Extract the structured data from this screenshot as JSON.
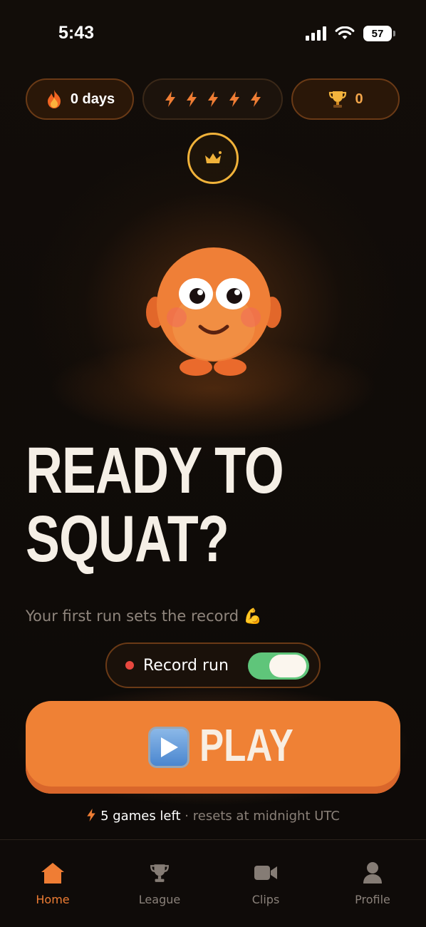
{
  "status_bar": {
    "time": "5:43",
    "battery": "57"
  },
  "top_stats": {
    "streak_label": "0 days",
    "energy_bolts": [
      "⚡",
      "⚡",
      "⚡",
      "⚡",
      "⚡"
    ],
    "trophies": "0"
  },
  "hero": {
    "headline_line1": "READY TO",
    "headline_line2": "SQUAT?",
    "subtitle": "Your first run sets the record 💪"
  },
  "record": {
    "label": "Record run",
    "enabled": true
  },
  "play": {
    "label": "PLAY"
  },
  "games": {
    "count_text": "5 games left",
    "reset_text": " · resets at midnight UTC"
  },
  "tabs": [
    {
      "label": "Home",
      "icon": "home-icon",
      "active": true
    },
    {
      "label": "League",
      "icon": "trophy-icon",
      "active": false
    },
    {
      "label": "Clips",
      "icon": "video-icon",
      "active": false
    },
    {
      "label": "Profile",
      "icon": "person-icon",
      "active": false
    }
  ],
  "colors": {
    "accent": "#ef7d34",
    "toggle_on": "#5fc57a",
    "crown": "#f0b23a"
  }
}
